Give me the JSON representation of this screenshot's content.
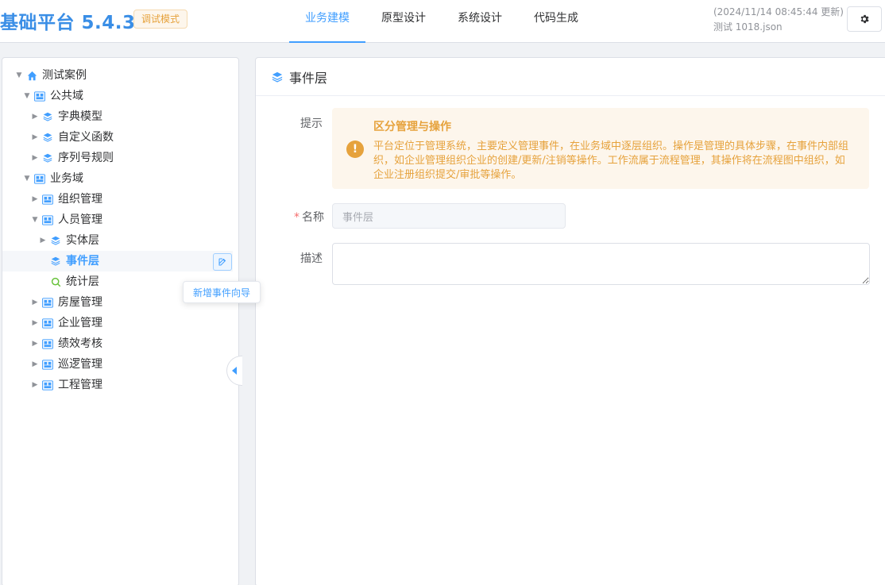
{
  "header": {
    "brand": "基础平台 5.4.3",
    "mode_badge": "调试模式",
    "nav": [
      {
        "label": "业务建模",
        "active": true
      },
      {
        "label": "原型设计",
        "active": false
      },
      {
        "label": "系统设计",
        "active": false
      },
      {
        "label": "代码生成",
        "active": false
      }
    ],
    "updated_text": "(2024/11/14 08:45:44 更新)",
    "file_name": "测试 1018.json",
    "settings_icon": "gear-icon"
  },
  "tree": {
    "items": [
      {
        "label": "测试案例",
        "level": 0,
        "caret": "down",
        "icon": "home-icon"
      },
      {
        "label": "公共域",
        "level": 1,
        "caret": "down",
        "icon": "domain-icon"
      },
      {
        "label": "字典模型",
        "level": 2,
        "caret": "right",
        "icon": "layers-icon"
      },
      {
        "label": "自定义函数",
        "level": 2,
        "caret": "right",
        "icon": "layers-icon"
      },
      {
        "label": "序列号规则",
        "level": 2,
        "caret": "right",
        "icon": "layers-icon"
      },
      {
        "label": "业务域",
        "level": 1,
        "caret": "down",
        "icon": "domain-icon"
      },
      {
        "label": "组织管理",
        "level": 2,
        "caret": "right",
        "icon": "module-icon"
      },
      {
        "label": "人员管理",
        "level": 2,
        "caret": "down",
        "icon": "module-icon"
      },
      {
        "label": "实体层",
        "level": 3,
        "caret": "right",
        "icon": "layers-icon"
      },
      {
        "label": "事件层",
        "level": 3,
        "caret": "none",
        "icon": "layers-icon",
        "selected": true
      },
      {
        "label": "统计层",
        "level": 3,
        "caret": "none",
        "icon": "search-icon"
      },
      {
        "label": "房屋管理",
        "level": 2,
        "caret": "right",
        "icon": "module-icon"
      },
      {
        "label": "企业管理",
        "level": 2,
        "caret": "right",
        "icon": "module-icon"
      },
      {
        "label": "绩效考核",
        "level": 2,
        "caret": "right",
        "icon": "module-icon"
      },
      {
        "label": "巡逻管理",
        "level": 2,
        "caret": "right",
        "icon": "module-icon"
      },
      {
        "label": "工程管理",
        "level": 2,
        "caret": "right",
        "icon": "module-icon"
      }
    ],
    "tooltip": "新增事件向导"
  },
  "content": {
    "title": "事件层",
    "hint_label": "提示",
    "alert": {
      "title": "区分管理与操作",
      "desc": "平台定位于管理系统，主要定义管理事件，在业务域中逐层组织。操作是管理的具体步骤，在事件内部组织，如企业管理组织企业的创建/更新/注销等操作。工作流属于流程管理，其操作将在流程图中组织，如企业注册组织提交/审批等操作。"
    },
    "name_label": "名称",
    "name_required_mark": "*",
    "name_value": "事件层",
    "desc_label": "描述",
    "desc_value": ""
  },
  "colors": {
    "primary": "#409eff",
    "brand": "#3a8ee6",
    "warning": "#e6a23c",
    "warning_bg": "#fdf6ec",
    "search_icon": "#67c23a"
  }
}
